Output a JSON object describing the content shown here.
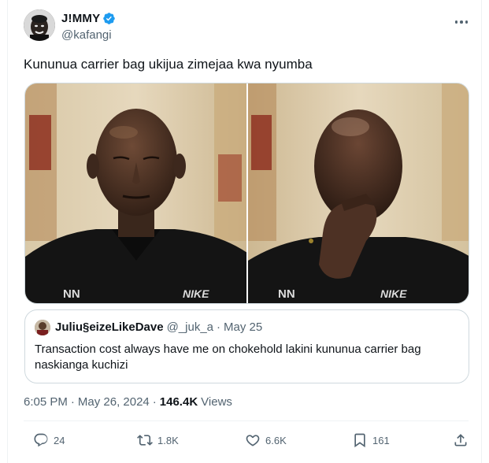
{
  "author": {
    "display_name": "J!MMY",
    "handle": "@kafangi"
  },
  "tweet": {
    "text": "Kununua carrier bag ukijua zimejaa kwa nyumba",
    "brand_marks": [
      "NN",
      "NIKE"
    ]
  },
  "quoted": {
    "display_name": "Juliu§eizeLikeDave",
    "handle": "@_juk_a",
    "separator": "·",
    "date": "May 25",
    "text": "Transaction cost always have me on chokehold lakini kununua carrier bag naskianga kuchizi"
  },
  "meta": {
    "time": "6:05 PM",
    "separator": "·",
    "date": "May 26, 2024",
    "views_count": "146.4K",
    "views_label": "Views"
  },
  "actions": {
    "replies": "24",
    "reposts": "1.8K",
    "likes": "6.6K",
    "bookmarks": "161"
  },
  "icons": [
    "verified-badge-icon",
    "more-icon",
    "reply-icon",
    "repost-icon",
    "like-icon",
    "bookmark-icon",
    "share-icon"
  ],
  "colors": {
    "verified": "#1d9bf0",
    "secondary_text": "#536471",
    "border": "#cfd9de"
  }
}
